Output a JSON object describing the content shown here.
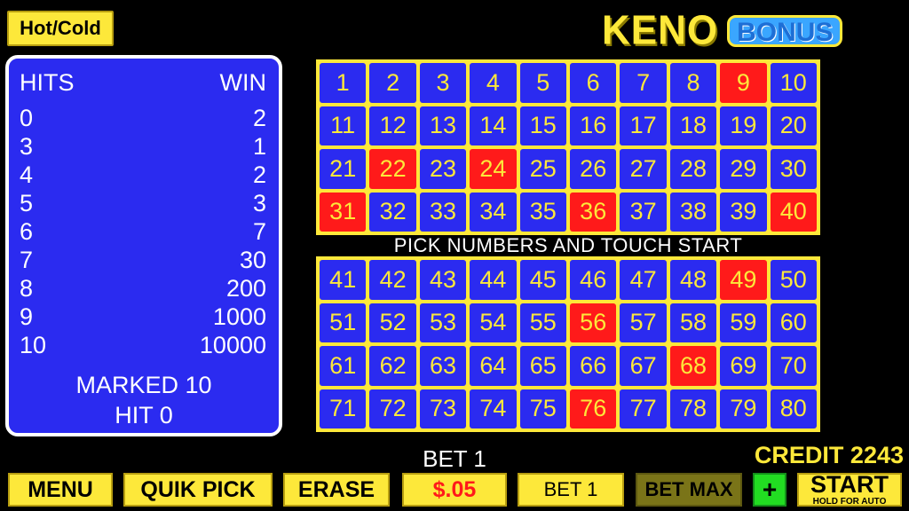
{
  "hotcold_label": "Hot/Cold",
  "logo": {
    "keno": "KENO",
    "bonus": "BONUS"
  },
  "paytable": {
    "hits_header": "HITS",
    "win_header": "WIN",
    "rows": [
      {
        "hits": "0",
        "win": "2"
      },
      {
        "hits": "3",
        "win": "1"
      },
      {
        "hits": "4",
        "win": "2"
      },
      {
        "hits": "5",
        "win": "3"
      },
      {
        "hits": "6",
        "win": "7"
      },
      {
        "hits": "7",
        "win": "30"
      },
      {
        "hits": "8",
        "win": "200"
      },
      {
        "hits": "9",
        "win": "1000"
      },
      {
        "hits": "10",
        "win": "10000"
      }
    ],
    "marked": "MARKED 10",
    "hit": "HIT 0"
  },
  "board": {
    "top": [
      "1",
      "2",
      "3",
      "4",
      "5",
      "6",
      "7",
      "8",
      "9",
      "10",
      "11",
      "12",
      "13",
      "14",
      "15",
      "16",
      "17",
      "18",
      "19",
      "20",
      "21",
      "22",
      "23",
      "24",
      "25",
      "26",
      "27",
      "28",
      "29",
      "30",
      "31",
      "32",
      "33",
      "34",
      "35",
      "36",
      "37",
      "38",
      "39",
      "40"
    ],
    "bottom": [
      "41",
      "42",
      "43",
      "44",
      "45",
      "46",
      "47",
      "48",
      "49",
      "50",
      "51",
      "52",
      "53",
      "54",
      "55",
      "56",
      "57",
      "58",
      "59",
      "60",
      "61",
      "62",
      "63",
      "64",
      "65",
      "66",
      "67",
      "68",
      "69",
      "70",
      "71",
      "72",
      "73",
      "74",
      "75",
      "76",
      "77",
      "78",
      "79",
      "80"
    ],
    "marked_numbers": [
      9,
      22,
      24,
      31,
      36,
      40,
      49,
      56,
      68,
      76
    ],
    "marked_color": "#ff1a1a",
    "cell_color": "#2b2bf0",
    "number_color": "#fde83a"
  },
  "instruction": "PICK NUMBERS AND TOUCH START",
  "bet_display": "BET 1",
  "credit_display": "CREDIT 2243",
  "buttons": {
    "menu": "MENU",
    "quik_pick": "QUIK PICK",
    "erase": "ERASE",
    "denomination": "$.05",
    "bet_one": "BET 1",
    "bet_max": "BET MAX",
    "plus": "+",
    "start": "START",
    "start_sub": "HOLD FOR AUTO"
  }
}
